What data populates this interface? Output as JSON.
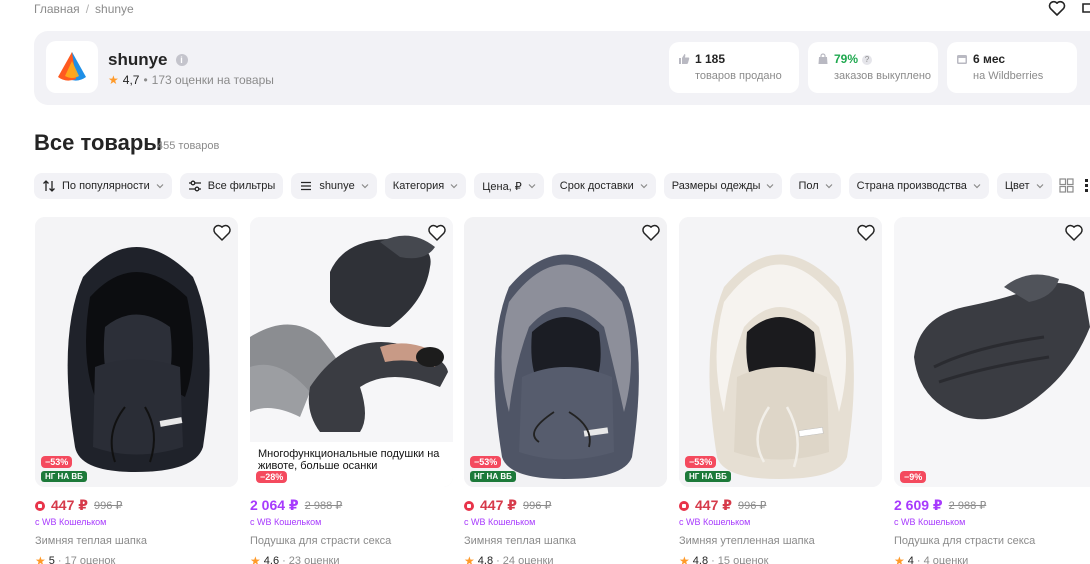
{
  "breadcrumb": {
    "home": "Главная",
    "separator": "/",
    "current": "shunye"
  },
  "header_icons": [
    "heart-icon",
    "share-icon"
  ],
  "seller": {
    "name": "shunye",
    "info_icon": "i",
    "rating": "4,7",
    "reviews": "173 оценки на товары",
    "stats": [
      {
        "icon": "thumb-up-icon",
        "value": "1 185",
        "label": "товаров продано"
      },
      {
        "icon": "bag-icon",
        "value": "79%",
        "label": "заказов выкуплено",
        "help": "?"
      },
      {
        "icon": "calendar-icon",
        "value": "6 мес",
        "label": "на Wildberries"
      }
    ]
  },
  "catalog": {
    "title": "Все товары",
    "count": "455 товаров"
  },
  "filters": [
    {
      "label": "По популярности",
      "icon": "sort-icon"
    },
    {
      "label": "Все фильтры",
      "icon": "sliders-icon"
    },
    {
      "label": "shunye",
      "icon": "menu-icon"
    },
    {
      "label": "Категория"
    },
    {
      "label": "Цена, ₽"
    },
    {
      "label": "Срок доставки"
    },
    {
      "label": "Размеры одежды"
    },
    {
      "label": "Пол"
    },
    {
      "label": "Страна производства"
    },
    {
      "label": "Цвет"
    }
  ],
  "view_icons": [
    "grid-large-icon",
    "grid-small-icon"
  ],
  "products": [
    {
      "discount": "−53%",
      "ng": "НГ НА ВБ",
      "price": "447 ₽",
      "old_price": "996 ₽",
      "wallet": "с WB Кошельком",
      "name": "Зимняя теплая шапка",
      "rating": "5",
      "reviews": "· 17 оценок",
      "overlay": ""
    },
    {
      "discount": "−28%",
      "ng": "",
      "price": "2 064 ₽",
      "old_price": "2 988 ₽",
      "wallet": "с WB Кошельком",
      "name": "Подушка для страсти секса",
      "rating": "4,6",
      "reviews": "· 23 оценки",
      "overlay": "Многофункциональные подушки на животе, больше осанки"
    },
    {
      "discount": "−53%",
      "ng": "НГ НА ВБ",
      "price": "447 ₽",
      "old_price": "996 ₽",
      "wallet": "с WB Кошельком",
      "name": "Зимняя теплая шапка",
      "rating": "4,8",
      "reviews": "· 24 оценки",
      "overlay": ""
    },
    {
      "discount": "−53%",
      "ng": "НГ НА ВБ",
      "price": "447 ₽",
      "old_price": "996 ₽",
      "wallet": "с WB Кошельком",
      "name": "Зимняя утепленная шапка",
      "rating": "4,8",
      "reviews": "· 15 оценок",
      "overlay": ""
    },
    {
      "discount": "−9%",
      "ng": "",
      "price": "2 609 ₽",
      "old_price": "2 988 ₽",
      "wallet": "с WB Кошельком",
      "name": "Подушка для страсти секса",
      "rating": "4",
      "reviews": "· 4 оценки",
      "overlay": ""
    }
  ],
  "colors": {
    "accent_purple": "#a73afd",
    "price_red": "#d63a4a",
    "discount_bg": "#f44a5e",
    "ng_bg": "#1d7a3a",
    "star": "#ff9a2a",
    "card_bg": "#f2f2f6"
  }
}
